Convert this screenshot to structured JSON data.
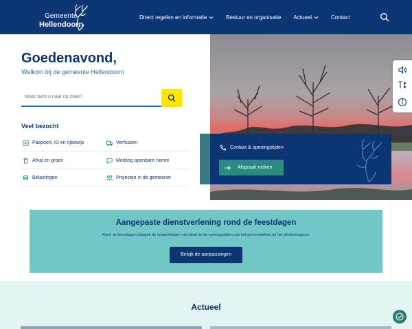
{
  "header": {
    "logo_line1": "Gemeente",
    "logo_line2": "Hellendoorn",
    "nav": [
      {
        "label": "Direct regelen en informatie"
      },
      {
        "label": "Bestuur en organisatie"
      },
      {
        "label": "Actueel"
      },
      {
        "label": "Contact"
      }
    ]
  },
  "hero": {
    "greeting": "Goedenavond,",
    "welcome": "Welkom bij de gemeente Hellendoorn",
    "search_placeholder": "Waar bent u naar op zoek?"
  },
  "most_visited": {
    "title": "Veel bezocht",
    "items": [
      {
        "label": "Paspoort, ID en rijbewijs",
        "icon": "id-card-icon"
      },
      {
        "label": "Verhuizen",
        "icon": "truck-icon"
      },
      {
        "label": "Afval en groen",
        "icon": "trash-icon"
      },
      {
        "label": "Melding openbare ruimte",
        "icon": "chat-icon"
      },
      {
        "label": "Belastingen",
        "icon": "coins-icon"
      },
      {
        "label": "Projecten in de gemeente",
        "icon": "people-icon"
      }
    ]
  },
  "contact": {
    "label": "Contact & openingstijden",
    "button": "Afspraak maken"
  },
  "notice": {
    "title": "Aangepaste dienstverlening rond de feestdagen",
    "text": "Rond de feestdagen wijzigen de inzameldagen van afval en de openingstijden van het gemeentehuis en het afvalbrengpunt.",
    "button": "Bekijk de aanpassingen"
  },
  "news": {
    "title": "Actueel"
  },
  "colors": {
    "brand": "#0c3573",
    "accent": "#ffe600",
    "teal": "#71c7c5",
    "button_teal": "#2b8b83"
  }
}
